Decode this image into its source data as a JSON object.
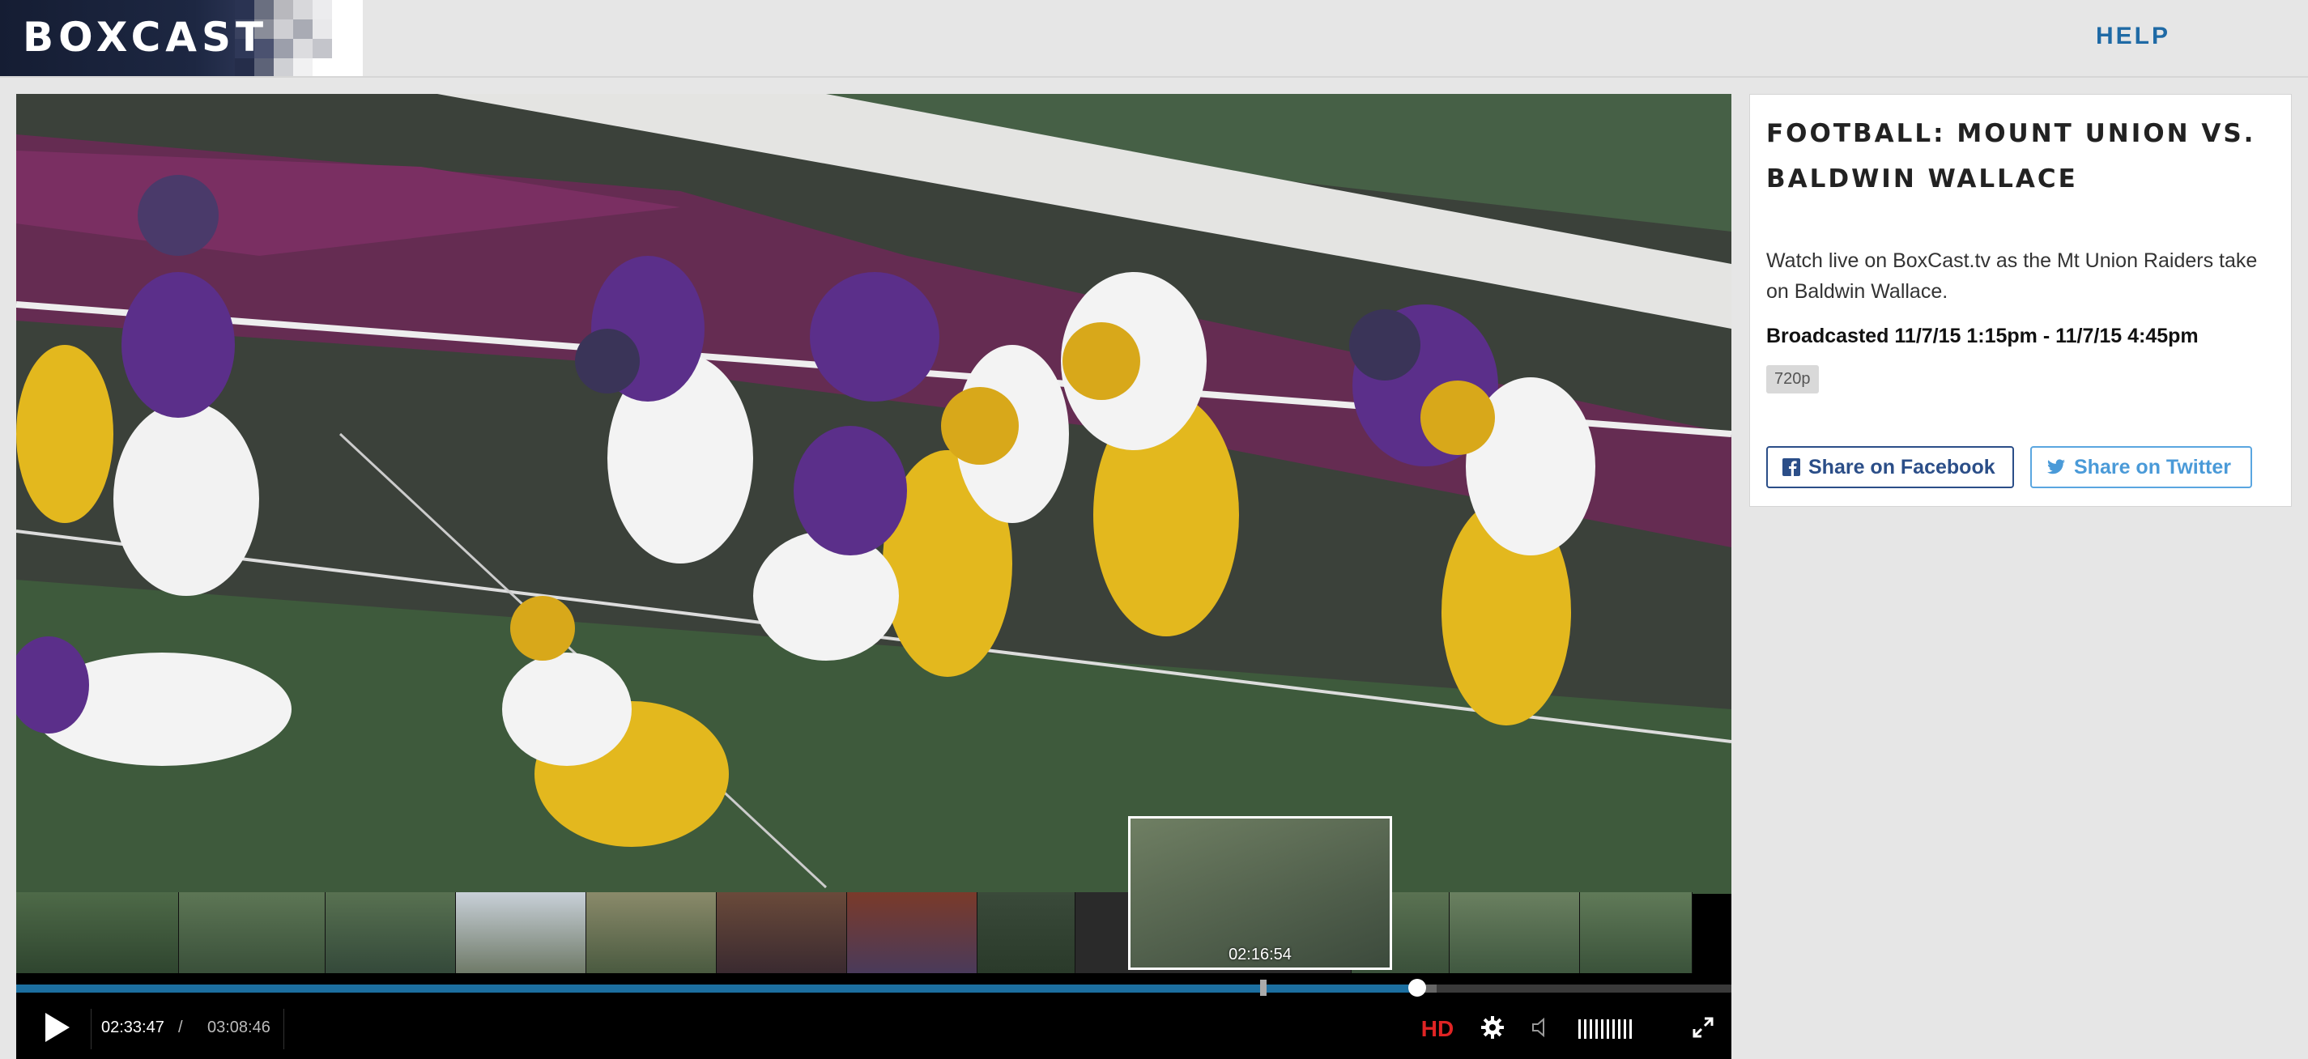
{
  "brand": {
    "logo_text": "BOXCAST"
  },
  "nav": {
    "help_label": "HELP"
  },
  "player": {
    "current_time": "02:33:47",
    "separator": "/",
    "duration": "03:08:46",
    "hover_time": "02:16:54",
    "progress_fraction": 0.817,
    "hover_fraction": 0.727,
    "hd_label": "HD",
    "icons": {
      "play": "play-icon",
      "settings": "gear-icon",
      "volume": "volume-icon",
      "fullscreen": "fullscreen-icon"
    }
  },
  "event": {
    "title": "FOOTBALL: MOUNT UNION VS. BALDWIN WALLACE",
    "description": "Watch live on BoxCast.tv as the Mt Union Raiders take on Baldwin Wallace.",
    "broadcast": "Broadcasted 11/7/15 1:15pm - 11/7/15 4:45pm",
    "quality_badge": "720p",
    "share_facebook": "Share on Facebook",
    "share_twitter": "Share on Twitter"
  },
  "colors": {
    "accent": "#1c6fa0",
    "hd": "#e02424",
    "facebook": "#2b4e88",
    "twitter": "#4a9ad8",
    "help": "#1f6aa5"
  }
}
